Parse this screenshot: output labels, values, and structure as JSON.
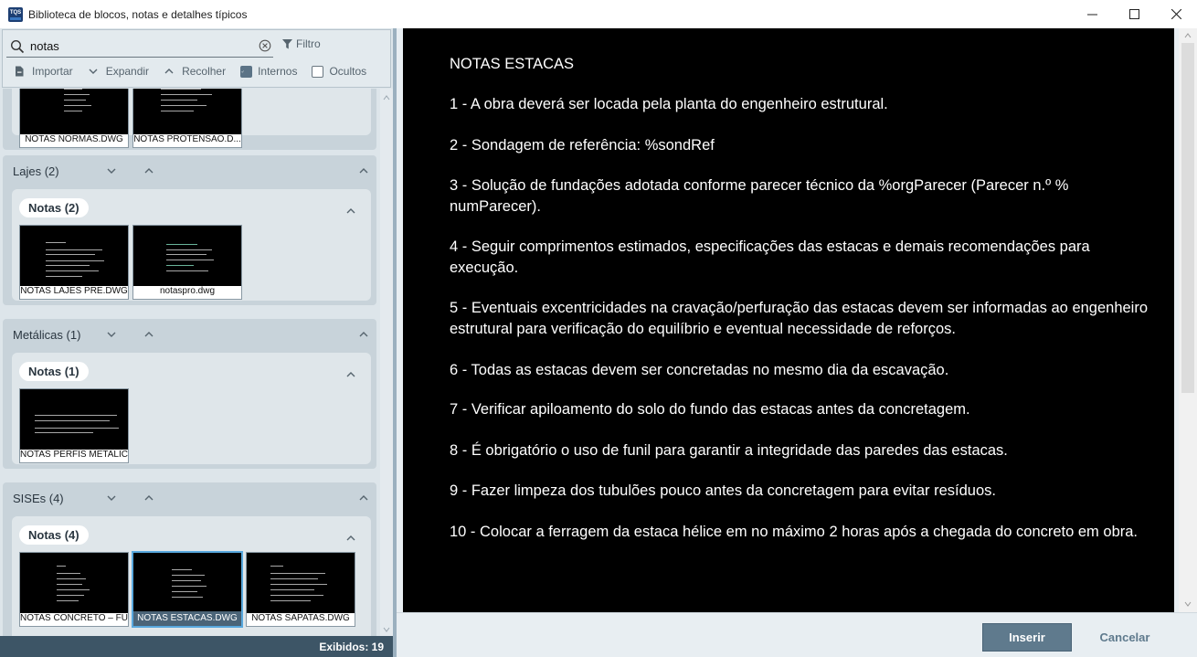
{
  "window": {
    "title": "Biblioteca de blocos, notas e detalhes típicos",
    "app_icon_text": "TQS"
  },
  "search": {
    "value": "notas",
    "placeholder": ""
  },
  "toolbar": {
    "filter_label": "Filtro",
    "import_label": "Importar",
    "expand_label": "Expandir",
    "collapse_label": "Recolher",
    "internal_label": "Internos",
    "internal_checked": true,
    "hidden_label": "Ocultos",
    "hidden_checked": false
  },
  "groups": [
    {
      "title": "",
      "thumbs": [
        {
          "label": "NOTAS NORMAS.DWG"
        },
        {
          "label": "NOTAS PROTENSAO.D..."
        }
      ]
    },
    {
      "title": "Lajes (2)",
      "sub": "Notas (2)",
      "thumbs": [
        {
          "label": "NOTAS LAJES PRE.DWG"
        },
        {
          "label": "notaspro.dwg"
        }
      ]
    },
    {
      "title": "Metálicas (1)",
      "sub": "Notas (1)",
      "thumbs": [
        {
          "label": "NOTAS PERFIS METALIC..."
        }
      ]
    },
    {
      "title": "SISEs (4)",
      "sub": "Notas (4)",
      "thumbs": [
        {
          "label": "NOTAS CONCRETO – FU..."
        },
        {
          "label": "NOTAS ESTACAS.DWG"
        },
        {
          "label": "NOTAS SAPATAS.DWG"
        }
      ]
    }
  ],
  "status": {
    "shown": "Exibidos: 19"
  },
  "preview": {
    "title": "NOTAS ESTACAS",
    "notes": [
      "1 - A obra deverá ser locada pela planta do engenheiro estrutural.",
      "2 - Sondagem de referência: %sondRef",
      "3 - Solução de fundações adotada conforme parecer técnico da %orgParecer (Parecer n.º % numParecer).",
      "4 - Seguir comprimentos estimados, especificações das estacas e demais recomendações para execução.",
      "5 - Eventuais excentricidades na cravação/perfuração das estacas devem ser informadas ao engenheiro estrutural para verificação do equilíbrio e eventual necessidade de reforços.",
      "6 - Todas as estacas devem ser concretadas no mesmo dia da escavação.",
      "7 - Verificar apiloamento do solo do fundo das estacas antes da concretagem.",
      "8 - É obrigatório o uso de funil para garantir a integridade das paredes das estacas.",
      "9 - Fazer limpeza dos tubulões pouco antes da concretagem para evitar resíduos.",
      "10 - Colocar a ferragem da estaca hélice em no máximo 2 horas após a chegada do concreto em obra."
    ]
  },
  "buttons": {
    "insert": "Inserir",
    "cancel": "Cancelar"
  },
  "colors": {
    "accent": "#5f7a8d",
    "status_bar": "#3d5566",
    "selection": "#58a8de"
  }
}
